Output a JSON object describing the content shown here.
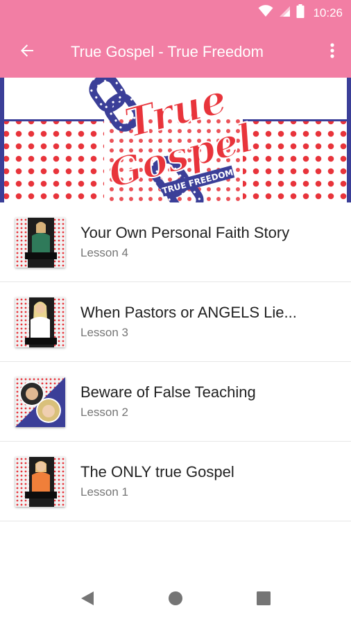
{
  "status_bar": {
    "time": "10:26",
    "icons": [
      "wifi-icon",
      "cell-signal-icon",
      "battery-icon"
    ]
  },
  "app_bar": {
    "title": "True Gospel - True Freedom",
    "back_icon": "arrow-back-icon",
    "overflow_icon": "more-vert-icon"
  },
  "banner": {
    "logo_line1": "True",
    "logo_line2": "Gospel",
    "logo_ribbon": "TRUE FREEDOM"
  },
  "lessons": [
    {
      "title": "Your Own Personal Faith Story",
      "subtitle": "Lesson 4"
    },
    {
      "title": "When Pastors or ANGELS Lie...",
      "subtitle": "Lesson 3"
    },
    {
      "title": "Beware of False Teaching",
      "subtitle": "Lesson 2"
    },
    {
      "title": "The ONLY true Gospel",
      "subtitle": "Lesson 1"
    }
  ],
  "nav_bar": {
    "back_icon": "nav-back-triangle-icon",
    "home_icon": "nav-home-circle-icon",
    "recents_icon": "nav-recents-square-icon"
  },
  "colors": {
    "app_bar": "#f27ea4",
    "polka_dot": "#e8343b",
    "chain_blue": "#3b3f98",
    "text_primary": "#212121",
    "text_secondary": "#757575"
  }
}
